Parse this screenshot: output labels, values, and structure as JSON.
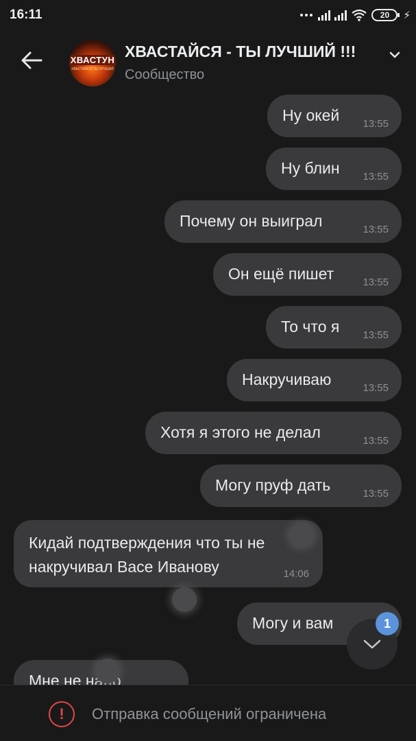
{
  "status_bar": {
    "time": "16:11",
    "battery": "20",
    "icons": [
      "more-dots-icon",
      "signal-icon",
      "signal-icon",
      "wifi-icon",
      "battery-icon",
      "charging-icon"
    ]
  },
  "header": {
    "title": "ХВАСТАЙСЯ - ТЫ ЛУЧШИЙ !!!",
    "subtitle": "Сообщество",
    "avatar_text": "ХВАСТУН",
    "avatar_subtext": "ХВАСТАЙСЯ ТЫ ЛУЧШИЙ"
  },
  "messages": [
    {
      "direction": "out",
      "text": "Ну окей",
      "time": "13:55"
    },
    {
      "direction": "out",
      "text": "Ну блин",
      "time": "13:55"
    },
    {
      "direction": "out",
      "text": "Почему он выиграл",
      "time": "13:55"
    },
    {
      "direction": "out",
      "text": "Он ещё пишет",
      "time": "13:55"
    },
    {
      "direction": "out",
      "text": "То что я",
      "time": "13:55"
    },
    {
      "direction": "out",
      "text": "Накручиваю",
      "time": "13:55"
    },
    {
      "direction": "out",
      "text": "Хотя я этого не делал",
      "time": "13:55"
    },
    {
      "direction": "out",
      "text": "Могу пруф дать",
      "time": "13:55"
    },
    {
      "direction": "in",
      "text": "Кидай подтверждения что ты не накручивал Васе Иванову",
      "time": "14:06"
    },
    {
      "direction": "out",
      "text": "Могу и вам",
      "time": ""
    },
    {
      "direction": "in",
      "text": "Мне не надо",
      "time": ""
    }
  ],
  "unread_count": "1",
  "footer": {
    "restriction_text": "Отправка сообщений ограничена"
  },
  "colors": {
    "background": "#19191a",
    "bubble": "#3a3a3d",
    "badge": "#5b93dc",
    "warning": "#e64646"
  }
}
